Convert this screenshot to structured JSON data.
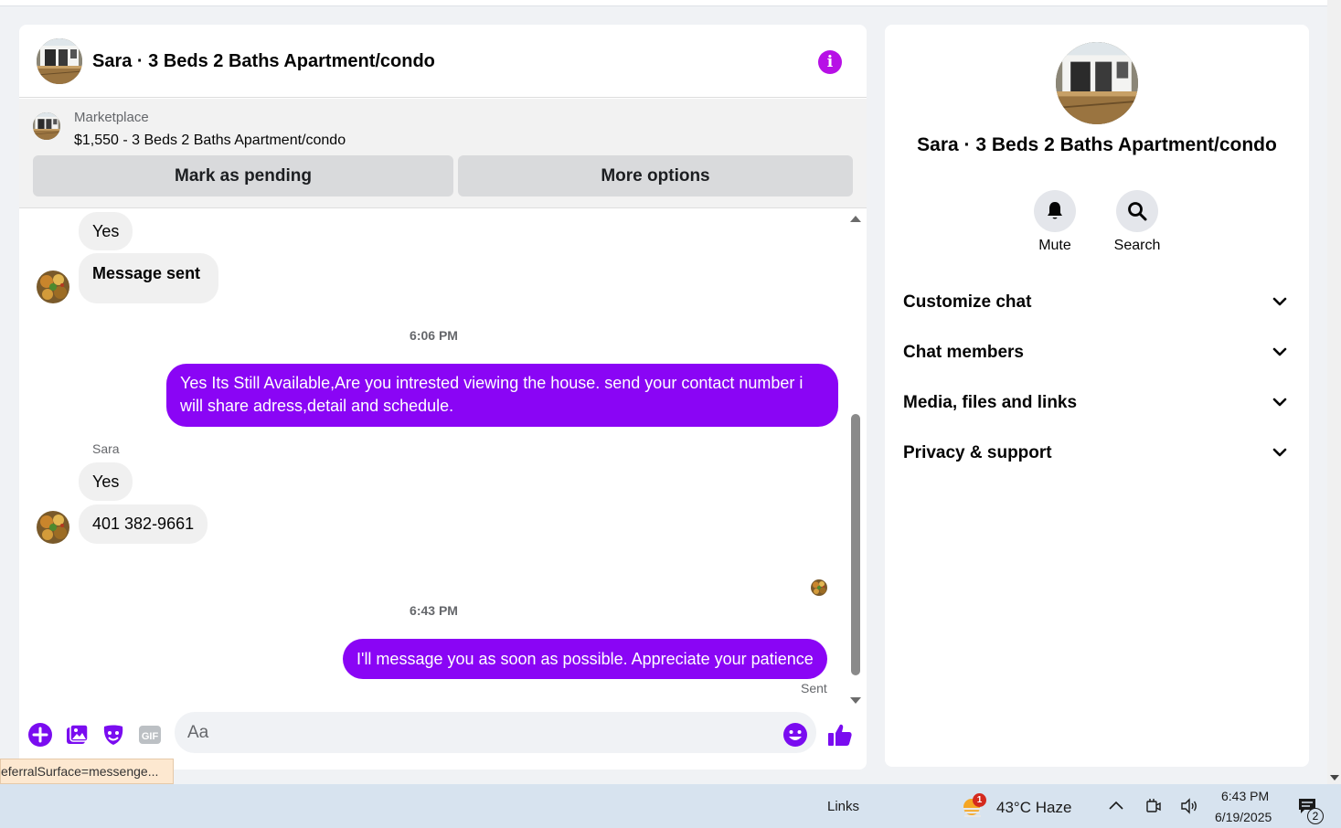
{
  "chat": {
    "title": "Sara · 3 Beds 2 Baths Apartment/condo",
    "info_icon": "info-icon"
  },
  "marketplace": {
    "label": "Marketplace",
    "listing": "$1,550 - 3 Beds 2 Baths Apartment/condo",
    "mark_pending": "Mark as pending",
    "more_options": "More options"
  },
  "messages": {
    "in_yes_1": "Yes",
    "in_message_sent": "Message sent",
    "time_1": "6:06 PM",
    "out_1": "Yes Its Still Available,Are you intrested viewing the house. send your contact number i will share adress,detail and schedule.",
    "sender": "Sara",
    "in_yes_2": "Yes",
    "in_phone": "401 382-9661",
    "time_2": "6:43 PM",
    "out_2": "I'll message you as soon as possible. Appreciate your patience",
    "status": "Sent"
  },
  "composer": {
    "placeholder": "Aa",
    "icons": [
      "plus-circle-icon",
      "photo-icon",
      "sticker-icon",
      "gif-icon",
      "emoji-icon",
      "thumbs-up-icon"
    ],
    "gif_text": "GIF"
  },
  "status_bar_url": "eferralSurface=messenge...",
  "info_panel": {
    "name": "Sara · 3 Beds 2 Baths Apartment/condo",
    "mute": "Mute",
    "search": "Search",
    "sections": [
      "Customize chat",
      "Chat members",
      "Media, files and links",
      "Privacy & support"
    ]
  },
  "taskbar": {
    "links": "Links",
    "weather_badge": "1",
    "weather": "43°C  Haze",
    "time": "6:43 PM",
    "date": "6/19/2025",
    "notification_count": "2"
  },
  "colors": {
    "accent": "#8a05f5",
    "info": "#b710e6",
    "composer_icons": "#7a0cf0"
  }
}
